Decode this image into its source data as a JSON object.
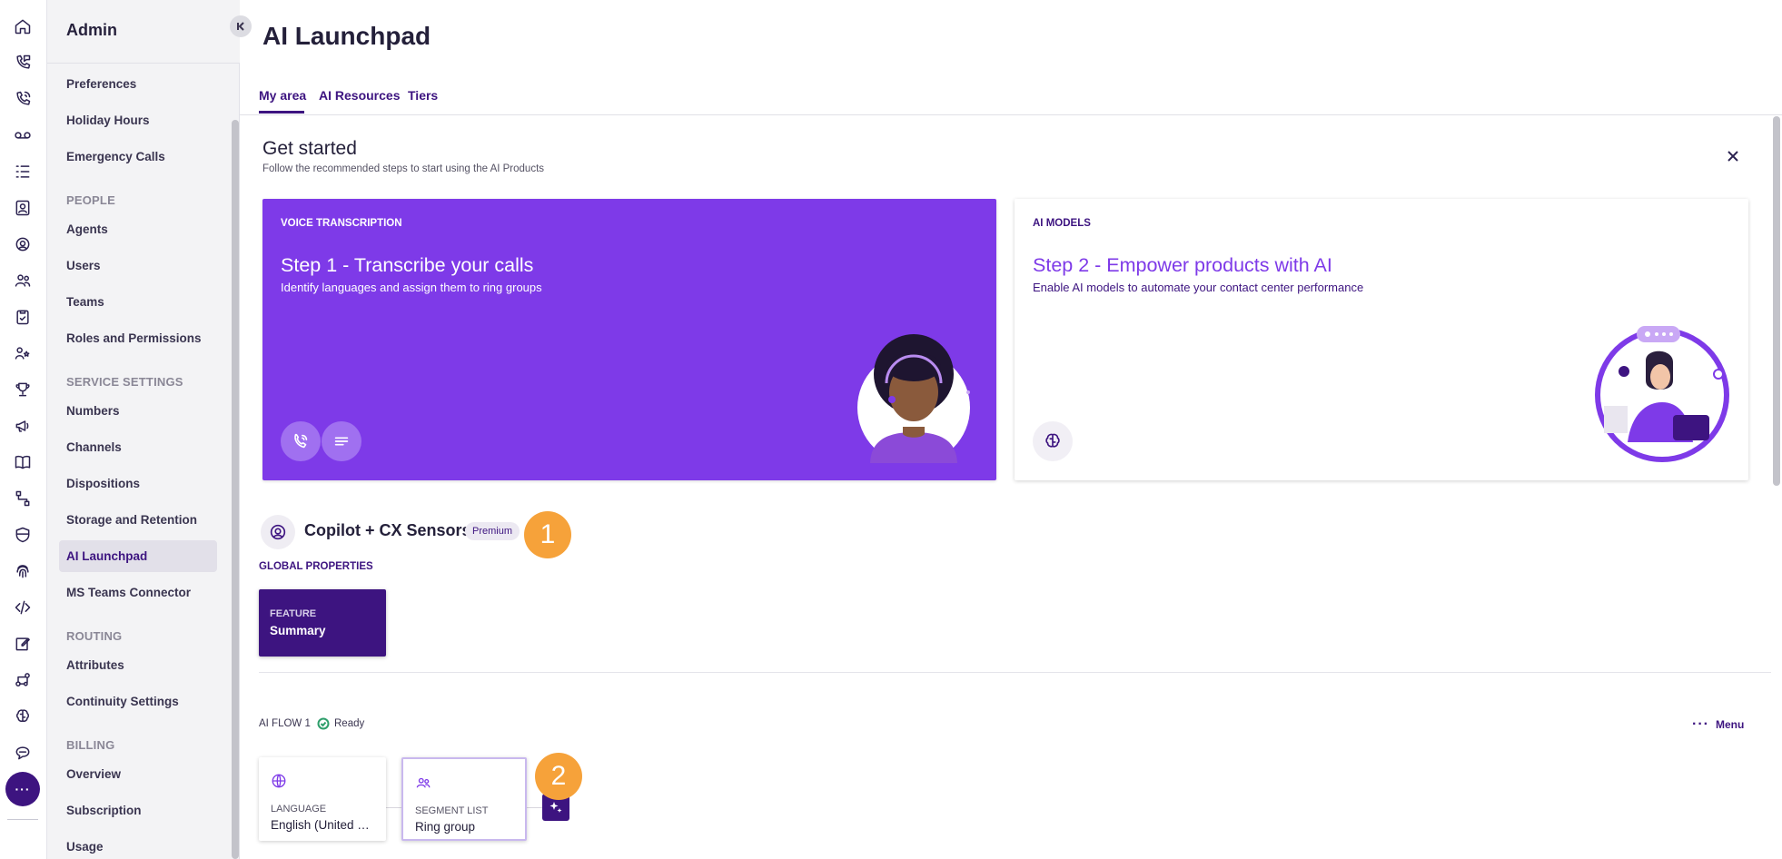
{
  "rail": {
    "icons": [
      "home-icon",
      "phone-chat-icon",
      "phone-call-icon",
      "voicemail-icon",
      "list-icon",
      "contact-card-icon",
      "headset-agent-icon",
      "team-icon",
      "clipboard-check-icon",
      "people-star-icon",
      "trophy-icon",
      "megaphone-icon",
      "book-icon",
      "flow-icon",
      "shield-icon",
      "fingerprint-icon",
      "code-icon",
      "edit-icon",
      "integration-icon",
      "brain-icon",
      "chat-bubble-icon"
    ],
    "more_label": "···"
  },
  "sidebar": {
    "title": "Admin",
    "items": [
      {
        "type": "item",
        "label": "Preferences"
      },
      {
        "type": "item",
        "label": "Holiday Hours"
      },
      {
        "type": "item",
        "label": "Emergency Calls"
      },
      {
        "type": "section",
        "label": "PEOPLE"
      },
      {
        "type": "item",
        "label": "Agents"
      },
      {
        "type": "item",
        "label": "Users"
      },
      {
        "type": "item",
        "label": "Teams"
      },
      {
        "type": "item",
        "label": "Roles and Permissions"
      },
      {
        "type": "section",
        "label": "SERVICE SETTINGS"
      },
      {
        "type": "item",
        "label": "Numbers"
      },
      {
        "type": "item",
        "label": "Channels"
      },
      {
        "type": "item",
        "label": "Dispositions"
      },
      {
        "type": "item",
        "label": "Storage and Retention"
      },
      {
        "type": "item",
        "label": "AI Launchpad",
        "active": true
      },
      {
        "type": "item",
        "label": "MS Teams Connector"
      },
      {
        "type": "section",
        "label": "ROUTING"
      },
      {
        "type": "item",
        "label": "Attributes"
      },
      {
        "type": "item",
        "label": "Continuity Settings"
      },
      {
        "type": "section",
        "label": "BILLING"
      },
      {
        "type": "item",
        "label": "Overview"
      },
      {
        "type": "item",
        "label": "Subscription"
      },
      {
        "type": "item",
        "label": "Usage"
      }
    ]
  },
  "page": {
    "title": "AI Launchpad",
    "tabs": [
      {
        "label": "My area",
        "active": true
      },
      {
        "label": "AI Resources"
      },
      {
        "label": "Tiers"
      }
    ]
  },
  "get_started": {
    "title": "Get started",
    "subtitle": "Follow the recommended steps to start using the AI Products",
    "cards": [
      {
        "kicker": "VOICE TRANSCRIPTION",
        "title": "Step 1 - Transcribe your calls",
        "description": "Identify languages and assign them to ring groups",
        "buttons": [
          "phone-ear-icon",
          "transcript-lines-icon"
        ]
      },
      {
        "kicker": "AI MODELS",
        "title": "Step 2 - Empower products with AI",
        "description": "Enable AI models to automate your contact center performance",
        "buttons": [
          "brain-icon"
        ]
      }
    ]
  },
  "copilot": {
    "title": "Copilot + CX Sensors",
    "badge": "Premium",
    "marker_1": "1",
    "global_properties_label": "GLOBAL PROPERTIES",
    "feature": {
      "kicker": "FEATURE",
      "value": "Summary"
    }
  },
  "flow": {
    "label": "AI FLOW 1",
    "status": "Ready",
    "menu_dots": "···",
    "menu_label": "Menu",
    "marker_2": "2",
    "nodes": [
      {
        "kicker": "LANGUAGE",
        "value": "English (United …",
        "icon": "globe-icon"
      },
      {
        "kicker": "SEGMENT LIST",
        "value": "Ring group",
        "icon": "group-icon"
      }
    ]
  },
  "colors": {
    "brand_dark": "#3d1480",
    "brand_purple": "#7e3ae8",
    "badge_orange": "#f6a23a",
    "ready_green": "#2e9e6b"
  }
}
